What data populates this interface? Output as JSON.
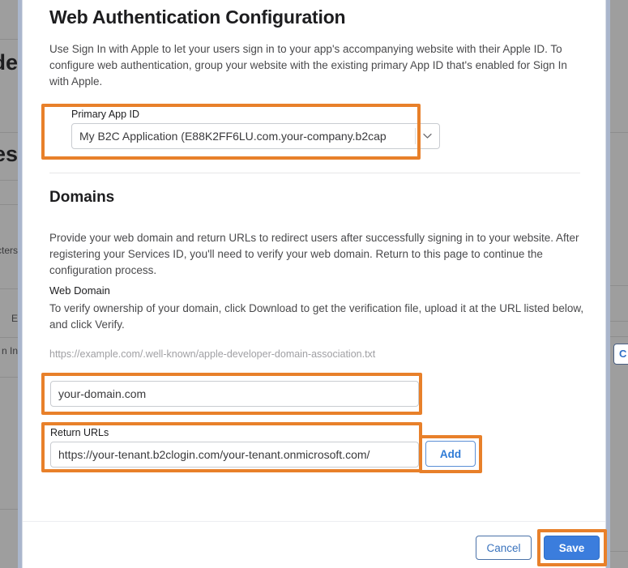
{
  "colors": {
    "highlight": "#e8802a",
    "primary_button": "#3b7ddd",
    "link": "#2f7bd6",
    "page_backdrop": "#9e9e9e",
    "gutter": "#aab6cc"
  },
  "background_page": {
    "fragments": [
      {
        "text": "de",
        "size": "big"
      },
      {
        "text": "ces",
        "size": "big"
      },
      {
        "text": "cters",
        "size": "sm"
      },
      {
        "text": "E",
        "size": "sm"
      },
      {
        "text": "n In",
        "size": "sm"
      }
    ],
    "clipped_button_label": "C"
  },
  "modal": {
    "title": "Web Authentication Configuration",
    "intro": "Use Sign In with Apple to let your users sign in to your app's accompanying website with their Apple ID. To configure web authentication, group your website with the existing primary App ID that's enabled for Sign In with Apple.",
    "primary_app_id": {
      "label": "Primary App ID",
      "value": "My B2C Application (E88K2FF6LU.com.your-company.b2cap",
      "arrow_icon": "chevron-down-icon"
    },
    "domains": {
      "title": "Domains",
      "description": "Provide your web domain and return URLs to redirect users after successfully signing in to your website. After registering your Services ID, you'll need to verify your web domain. Return to this page to continue the configuration process.",
      "web_domain": {
        "label": "Web Domain",
        "description": "To verify ownership of your domain, click Download to get the verification file, upload it at the URL listed below, and click Verify.",
        "verification_url": "https://example.com/.well-known/apple-developer-domain-association.txt",
        "input_value": "your-domain.com",
        "input_placeholder": "your-domain.com"
      },
      "return_urls": {
        "label": "Return URLs",
        "input_value": "https://your-tenant.b2clogin.com/your-tenant.onmicrosoft.com/",
        "input_placeholder": "https://",
        "add_label": "Add"
      }
    },
    "footer": {
      "cancel_label": "Cancel",
      "save_label": "Save"
    }
  }
}
